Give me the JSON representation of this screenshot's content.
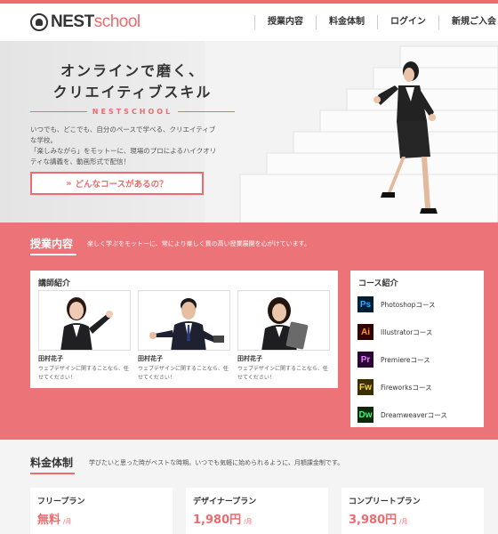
{
  "brand": {
    "logo_a": "NEST",
    "logo_b": "school"
  },
  "nav": {
    "items": [
      "授業内容",
      "料金体制",
      "ログイン",
      "新規ご入会"
    ]
  },
  "hero": {
    "title_line1": "オンラインで磨く、",
    "title_line2": "クリエイティブスキル",
    "brand_tag": "NESTSCHOOL",
    "desc_line1": "いつでも、どこでも、自分のペースで学べる、クリエイティブな学校。",
    "desc_line2": "「楽しみながら」をモットーに、現場のプロによるハイクオリティな講義を、動画形式で配信！",
    "cta_label": "どんなコースがあるの？",
    "cta_chevrons": "»"
  },
  "courses_section": {
    "title": "授業内容",
    "subtitle": "楽しく学ぶをモットーに、常により楽しく質の高い授業展開を心がけています。",
    "teachers_heading": "講師紹介",
    "teachers": [
      {
        "name": "田村花子",
        "desc": "ウェブデザインに関することなら、任せてください！"
      },
      {
        "name": "田村花子",
        "desc": "ウェブデザインに関することなら、任せてください！"
      },
      {
        "name": "田村花子",
        "desc": "ウェブデザインに関することなら、任せてください！"
      }
    ],
    "courses_heading": "コース紹介",
    "courses": [
      {
        "abbr": "Ps",
        "label": "Photoshopコース",
        "bg": "#001e36",
        "fg": "#31a8ff"
      },
      {
        "abbr": "Ai",
        "label": "Illustratorコース",
        "bg": "#330000",
        "fg": "#ff9a00"
      },
      {
        "abbr": "Pr",
        "label": "Premiereコース",
        "bg": "#2a0634",
        "fg": "#e77cff"
      },
      {
        "abbr": "Fw",
        "label": "Fireworksコース",
        "bg": "#3b2e00",
        "fg": "#f6d54a"
      },
      {
        "abbr": "Dw",
        "label": "Dreamweaverコース",
        "bg": "#0b2a0d",
        "fg": "#4cf27a"
      }
    ]
  },
  "pricing": {
    "title": "料金体制",
    "subtitle": "学びたいと思った時がベストな時期。いつでも気軽に始められるように、月額課金制です。",
    "plans": [
      {
        "name": "フリープラン",
        "price": "無料",
        "unit": "/月"
      },
      {
        "name": "デザイナープラン",
        "price": "1,980円",
        "unit": "/月"
      },
      {
        "name": "コンプリートプラン",
        "price": "3,980円",
        "unit": "/月"
      }
    ]
  },
  "colors": {
    "accent": "#ec6b6e",
    "section_bg": "#ec7377"
  }
}
